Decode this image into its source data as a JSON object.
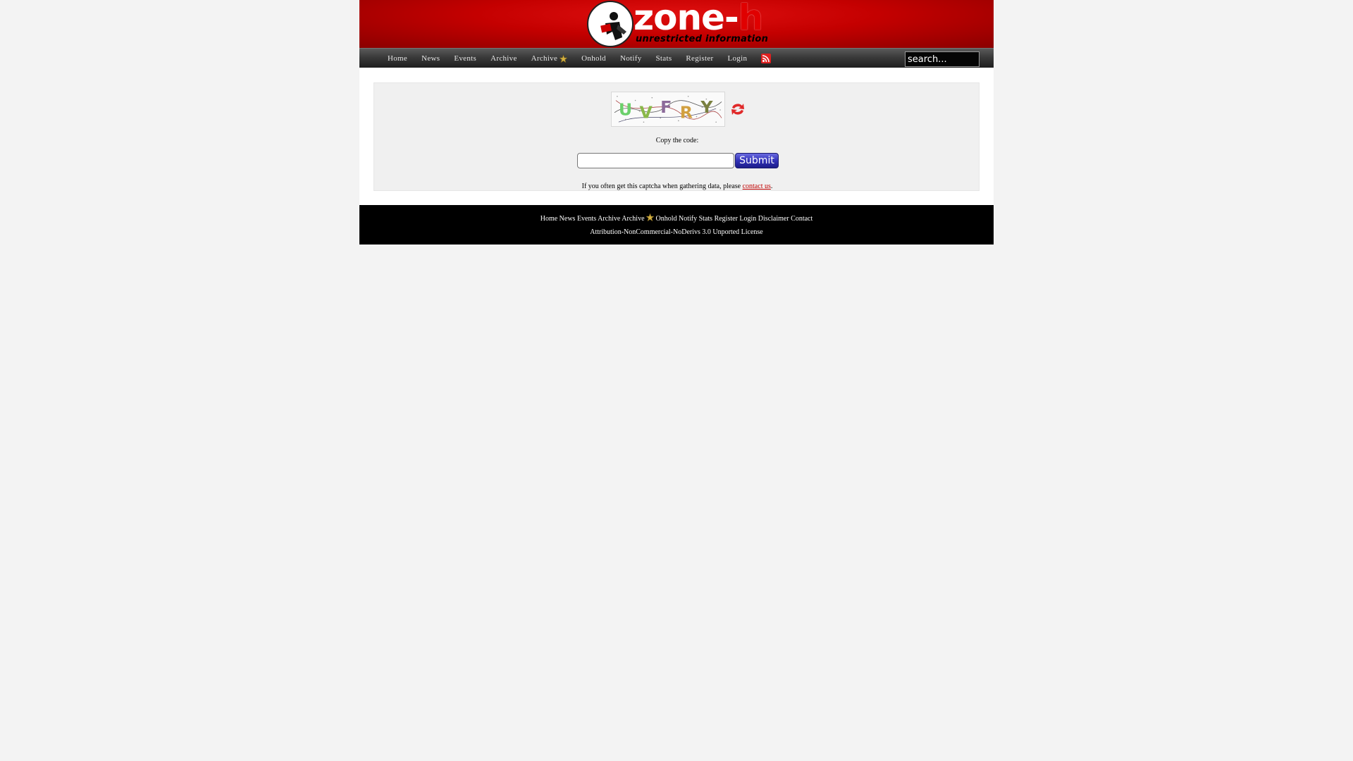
{
  "header": {
    "logo_word": "zone-",
    "logo_word_accent": "h",
    "logo_tagline": "unrestricted information"
  },
  "nav": {
    "items": [
      "Home",
      "News",
      "Events",
      "Archive",
      "Archive",
      "Onhold",
      "Notify",
      "Stats",
      "Register",
      "Login"
    ],
    "special_archive_icon": "star-icon",
    "rss_icon": "rss-icon"
  },
  "search": {
    "placeholder": "search..."
  },
  "captcha": {
    "image_text": "UVFRY",
    "refresh_icon": "refresh-icon",
    "copy_label": "Copy the code:",
    "input_value": "",
    "submit_label": "Submit",
    "notice_text": "If you often get this captcha when gathering data, please ",
    "notice_link": "contact us",
    "notice_end": "."
  },
  "footer": {
    "links": [
      "Home",
      "News",
      "Events",
      "Archive",
      "Archive",
      "Onhold",
      "Notify",
      "Stats",
      "Register",
      "Login",
      "Disclaimer",
      "Contact"
    ],
    "license": "Attribution-NonCommercial-NoDerivs 3.0 Unported License"
  },
  "colors": {
    "banner_red": "#c40000",
    "nav_dark": "#2a2a2a",
    "submit_blue": "#3232b8",
    "link_red": "#c00000",
    "star_gold": "#d4b040"
  }
}
